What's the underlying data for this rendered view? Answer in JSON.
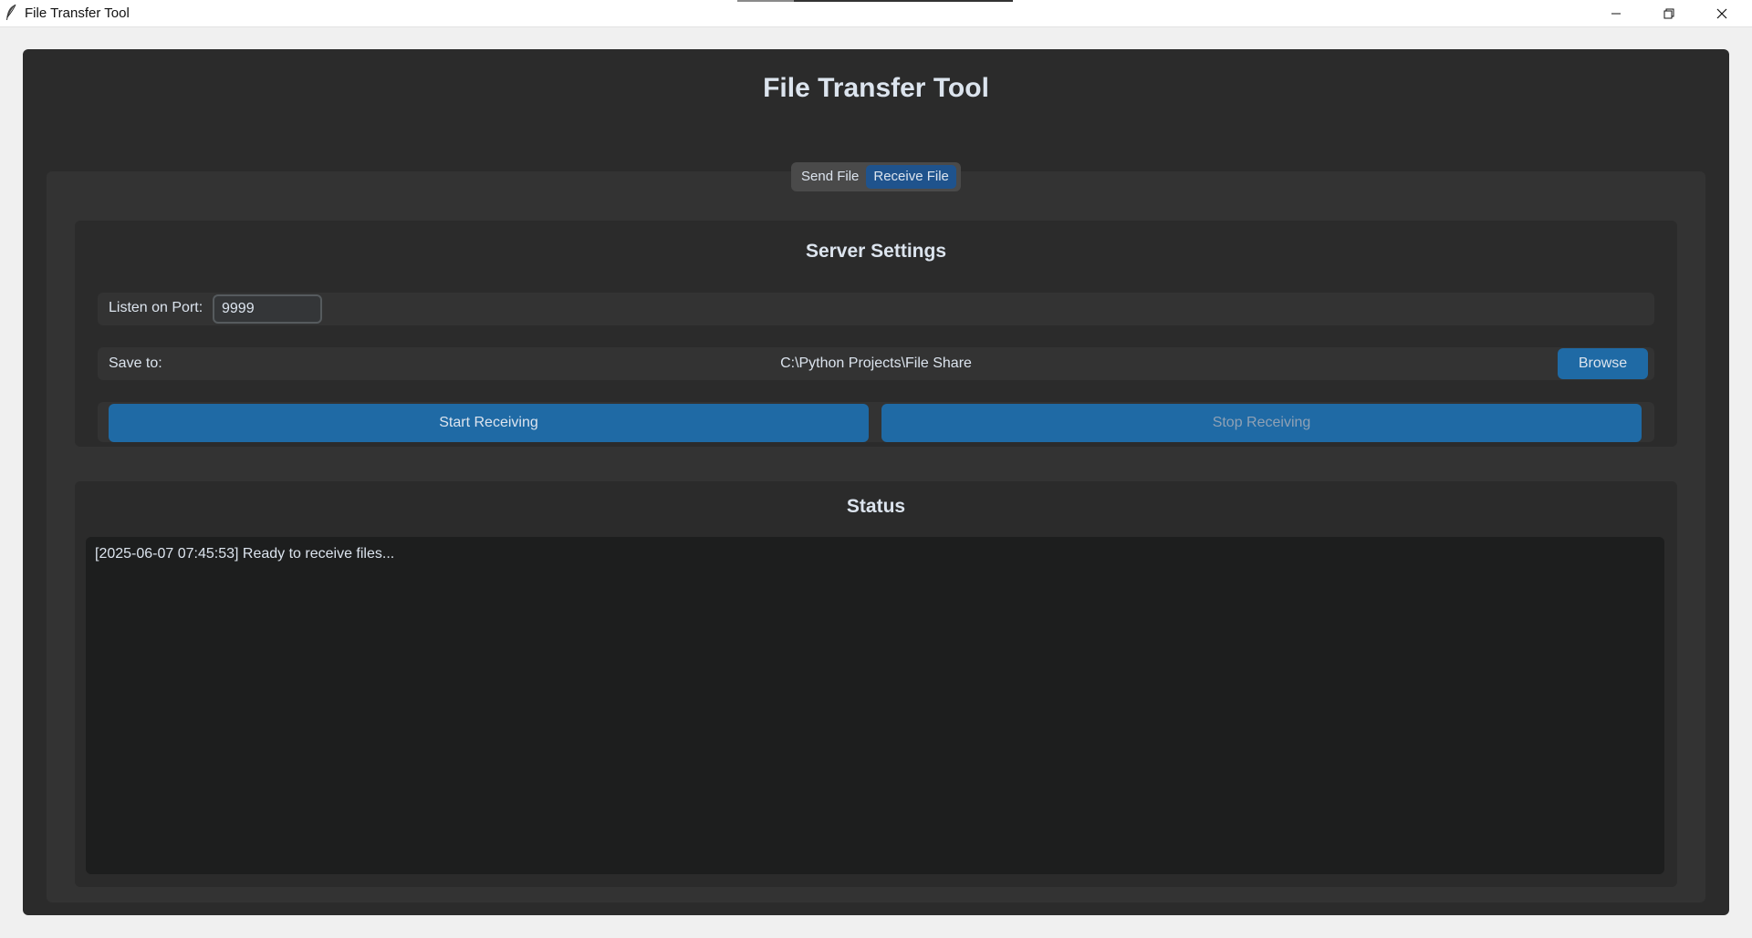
{
  "window": {
    "title": "File Transfer Tool",
    "icon": "feather-icon",
    "controls": [
      "minimize-icon",
      "restore-icon",
      "close-icon"
    ]
  },
  "app": {
    "heading": "File Transfer Tool",
    "tabs": [
      {
        "label": "Send File",
        "active": false
      },
      {
        "label": "Receive File",
        "active": true
      }
    ],
    "accent_color": "#1f6aa5",
    "active_tab_color": "#1f538d"
  },
  "server_settings": {
    "heading": "Server Settings",
    "port_label": "Listen on Port:",
    "port_value": "9999",
    "save_label": "Save to:",
    "save_path": "C:\\Python Projects\\File Share",
    "browse_label": "Browse",
    "start_label": "Start Receiving",
    "stop_label": "Stop Receiving",
    "stop_disabled": true
  },
  "status": {
    "heading": "Status",
    "log_lines": [
      "[2025-06-07 07:45:53] Ready to receive files..."
    ]
  }
}
